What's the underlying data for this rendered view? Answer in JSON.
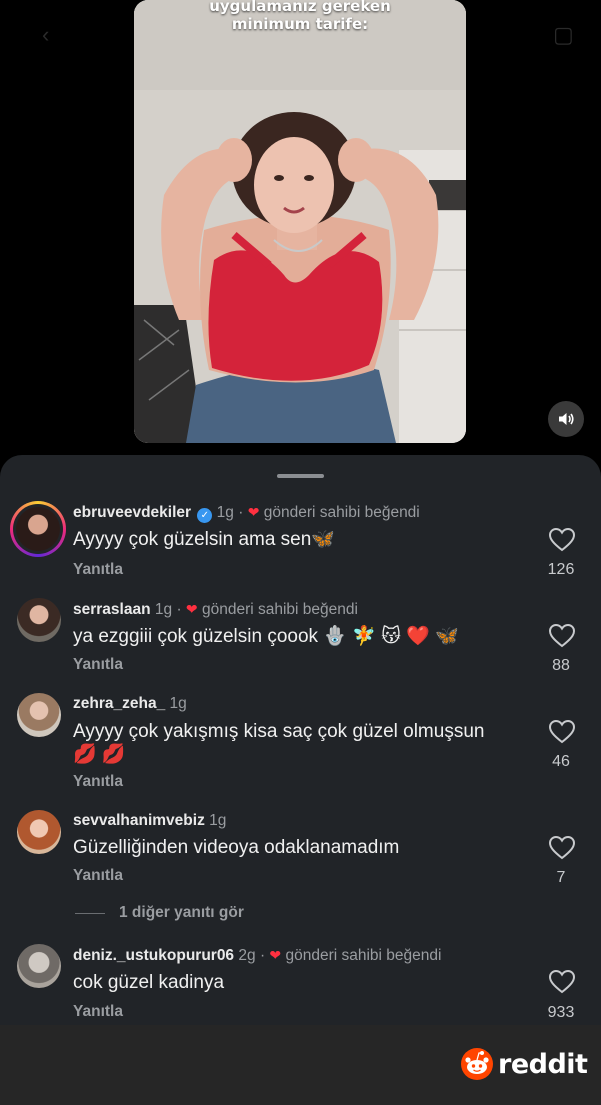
{
  "video": {
    "caption_line1": "uygulamanız gereken",
    "caption_line2": "minimum tarife:"
  },
  "comments": [
    {
      "username": "ebruveevdekiler",
      "verified": true,
      "time": "1g",
      "liked_text": "gönderi sahibi beğendi",
      "text_line1": "Ayyyy çok güzelsin ama sen🦋",
      "reply": "Yanıtla",
      "likes": "126"
    },
    {
      "username": "serraslaan",
      "time": "1g",
      "liked_text": "gönderi sahibi beğendi",
      "text_line1": "ya ezggiii çok güzelsin çoook 🪬 🧚 😽 ❤️ 🦋",
      "reply": "Yanıtla",
      "likes": "88"
    },
    {
      "username": "zehra_zeha_",
      "time": "1g",
      "text_line1": "Ayyyy çok yakışmış kisa saç çok güzel olmuşsun",
      "text_line2": "💋 💋",
      "reply": "Yanıtla",
      "likes": "46"
    },
    {
      "username": "sevvalhanimvebiz",
      "time": "1g",
      "text_line1": "Güzelliğinden videoya odaklanamadım",
      "reply": "Yanıtla",
      "likes": "7",
      "more_replies": "1 diğer yanıtı gör"
    },
    {
      "username": "deniz._ustukopurur06",
      "time": "2g",
      "liked_text": "gönderi sahibi beğendi",
      "text_line1": "cok güzel kadinya",
      "reply": "Yanıtla",
      "likes": "933"
    }
  ],
  "watermark": {
    "brand": "reddit"
  },
  "icons": {
    "sound": "speaker-icon",
    "like": "heart-outline-icon",
    "owner_like": "heart-filled-icon",
    "verified": "verified-badge-icon"
  },
  "colors": {
    "sheet_bg": "#212428",
    "owner_heart": "#ff3040",
    "verified": "#3897f0",
    "reddit_orange": "#ff4500"
  }
}
